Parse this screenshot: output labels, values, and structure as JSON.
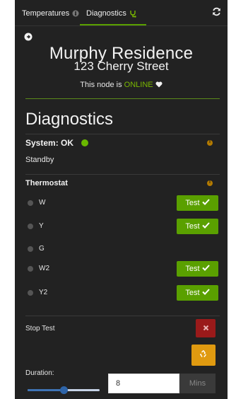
{
  "navbar": {
    "tabs": [
      {
        "label": "Temperatures",
        "icon": "thermometer-icon"
      },
      {
        "label": "Diagnostics",
        "icon": "stethoscope-icon"
      }
    ],
    "refresh_icon": "refresh-icon"
  },
  "header": {
    "residence": "Murphy Residence",
    "address": "123 Cherry Street",
    "node_status_prefix": "This node is",
    "node_status_value": "ONLINE"
  },
  "diagnostics": {
    "heading": "Diagnostics",
    "system_label": "System: OK",
    "system_state": "Standby",
    "thermostat_label": "Thermostat",
    "test_label": "Test",
    "wires": [
      {
        "label": "W",
        "has_test": true
      },
      {
        "label": "Y",
        "has_test": true
      },
      {
        "label": "G",
        "has_test": false
      },
      {
        "label": "W2",
        "has_test": true
      },
      {
        "label": "Y2",
        "has_test": true
      }
    ],
    "stop_test_label": "Stop Test",
    "duration_label": "Duration:",
    "duration_value": "8",
    "duration_unit": "Mins",
    "slider_fraction": 0.5
  },
  "colors": {
    "accent_green": "#5aa000",
    "online_green": "#7ab800",
    "stop_red": "#9a1a1a",
    "recycle_orange": "#e09a10",
    "panel_bg": "#222222"
  }
}
